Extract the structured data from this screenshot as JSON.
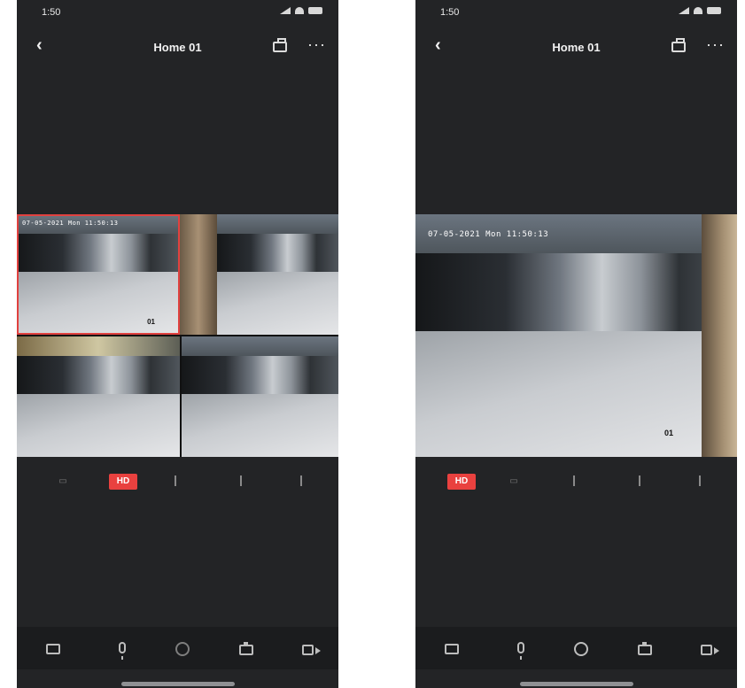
{
  "screens": [
    {
      "id": "left",
      "status": {
        "time": "1:50"
      },
      "nav": {
        "back": "‹",
        "title": "Home 01",
        "more": "···"
      },
      "view": "grid",
      "cameras": [
        {
          "osd": "07-05-2021 Mon 11:50:13",
          "label": "01",
          "selected": true
        },
        {
          "osd": "",
          "label": "",
          "selected": false
        },
        {
          "osd": "",
          "label": "",
          "selected": false
        },
        {
          "osd": "",
          "label": "",
          "selected": false
        }
      ],
      "controls": {
        "active": "HD"
      }
    },
    {
      "id": "right",
      "status": {
        "time": "1:50"
      },
      "nav": {
        "back": "‹",
        "title": "Home 01",
        "more": "···"
      },
      "view": "single",
      "cameras": [
        {
          "osd": "07-05-2021 Mon 11:50:13",
          "label": "01",
          "selected": true
        }
      ],
      "controls": {
        "active": "HD"
      }
    }
  ],
  "toolbar": {
    "tools": [
      "camera-icon",
      "microphone-icon",
      "ptz-icon",
      "snapshot-icon",
      "record-icon"
    ]
  },
  "colors": {
    "accent": "#e9413f",
    "background": "#232426",
    "toolbar": "#1b1c1e"
  }
}
